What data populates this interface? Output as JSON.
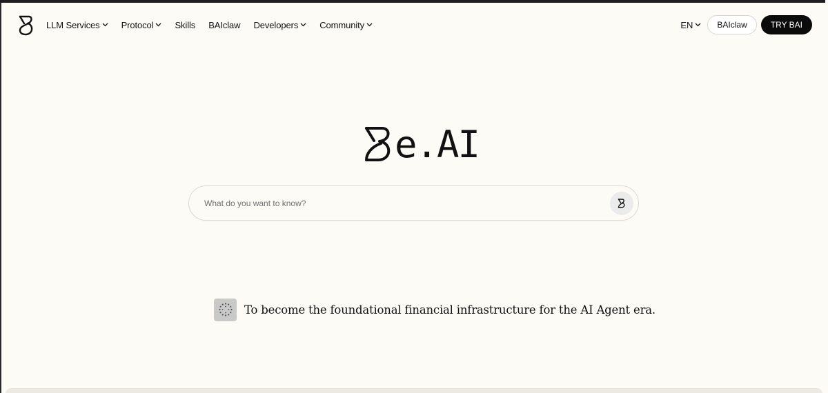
{
  "nav": {
    "items": [
      {
        "label": "LLM Services",
        "has_dropdown": true
      },
      {
        "label": "Protocol",
        "has_dropdown": true
      },
      {
        "label": "Skills",
        "has_dropdown": false
      },
      {
        "label": "BAIclaw",
        "has_dropdown": false
      },
      {
        "label": "Developers",
        "has_dropdown": true
      },
      {
        "label": "Community",
        "has_dropdown": true
      }
    ],
    "language": "EN",
    "baiclaw_button": "BAIclaw",
    "try_button": "TRY BAI"
  },
  "hero": {
    "logo_text": "e.AI"
  },
  "search": {
    "placeholder": "What do you want to know?",
    "value": ""
  },
  "tagline": {
    "text": "To become the foundational financial infrastructure for the AI Agent era."
  },
  "colors": {
    "background": "#fcfbf5",
    "accent_dark": "#0b0b0b",
    "submit_bg": "#ebebeb"
  },
  "icons": {
    "brand": "b-logo-icon",
    "dropdown": "chevron-down-icon",
    "submit": "b-logo-icon",
    "tagline": "loading-dots-icon"
  }
}
